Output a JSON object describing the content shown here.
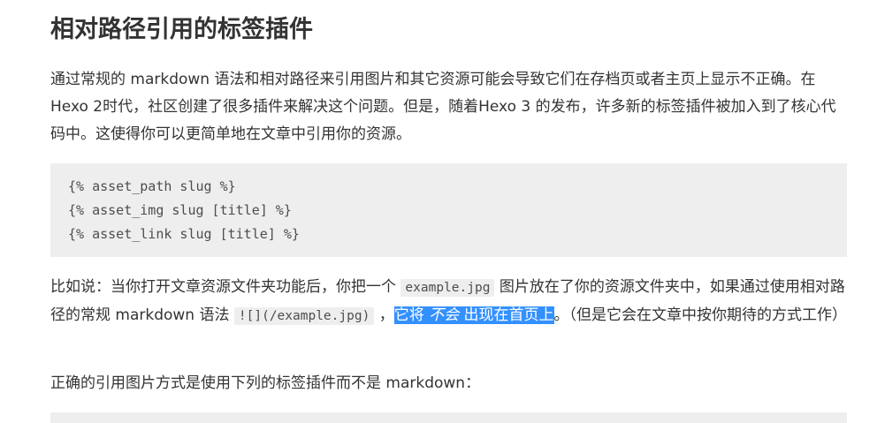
{
  "heading": "相对路径引用的标签插件",
  "intro": "通过常规的 markdown 语法和相对路径来引用图片和其它资源可能会导致它们在存档页或者主页上显示不正确。在Hexo 2时代，社区创建了很多插件来解决这个问题。但是，随着Hexo 3 的发布，许多新的标签插件被加入到了核心代码中。这使得你可以更简单地在文章中引用你的资源。",
  "code_lines": [
    "{% asset_path slug %}",
    "{% asset_img slug [title] %}",
    "{% asset_link slug [title] %}"
  ],
  "example": {
    "part1": "比如说：当你打开文章资源文件夹功能后，你把一个",
    "code1": "example.jpg",
    "part2": "图片放在了你的资源文件夹中，如果通过使用相对路径的常规 markdown 语法",
    "code2": "![](/example.jpg)",
    "part3": "，",
    "selected_before": "它将 ",
    "selected_em": "不会",
    "selected_after": " 出现在首页上",
    "part4": "。（但是它会在文章中按你期待的方式工作）"
  },
  "conclusion": "正确的引用图片方式是使用下列的标签插件而不是 markdown："
}
